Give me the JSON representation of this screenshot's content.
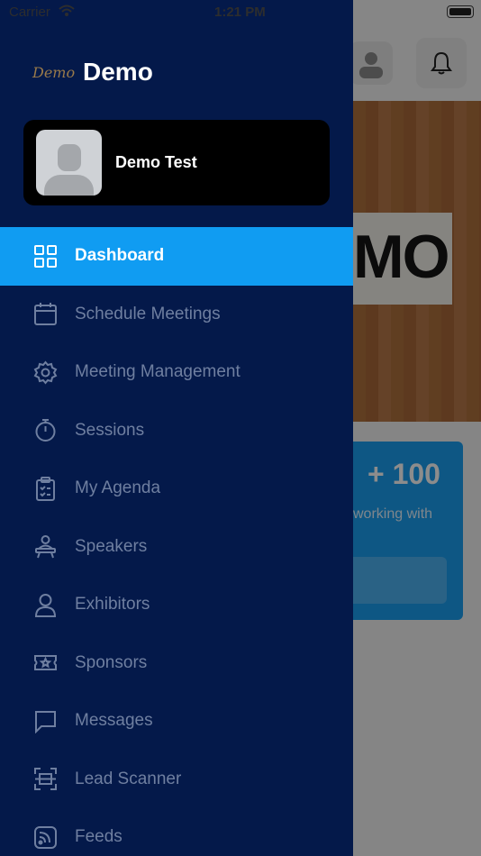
{
  "status_bar": {
    "carrier": "Carrier",
    "time": "1:21 PM"
  },
  "brand": {
    "logo_text": "Demo",
    "name": "Demo"
  },
  "profile": {
    "name": "Demo Test"
  },
  "menu": {
    "items": [
      {
        "label": "Dashboard",
        "icon": "grid-icon",
        "active": true
      },
      {
        "label": "Schedule Meetings",
        "icon": "calendar-icon",
        "active": false
      },
      {
        "label": "Meeting Management",
        "icon": "gear-icon",
        "active": false
      },
      {
        "label": "Sessions",
        "icon": "stopwatch-icon",
        "active": false
      },
      {
        "label": "My Agenda",
        "icon": "clipboard-check-icon",
        "active": false
      },
      {
        "label": "Speakers",
        "icon": "speaker-podium-icon",
        "active": false
      },
      {
        "label": "Exhibitors",
        "icon": "person-icon",
        "active": false
      },
      {
        "label": "Sponsors",
        "icon": "ticket-star-icon",
        "active": false
      },
      {
        "label": "Messages",
        "icon": "chat-bubble-icon",
        "active": false
      },
      {
        "label": "Lead Scanner",
        "icon": "scanner-icon",
        "active": false
      },
      {
        "label": "Feeds",
        "icon": "rss-icon",
        "active": false
      }
    ]
  },
  "background": {
    "hero_text": "MO",
    "card_number": "+ 100",
    "card_text": "working with"
  },
  "colors": {
    "drawer_bg": "#04194a",
    "active_bg": "#109cf2",
    "inactive_text": "#6f7fa0",
    "card_bg": "#1b9ef0"
  }
}
